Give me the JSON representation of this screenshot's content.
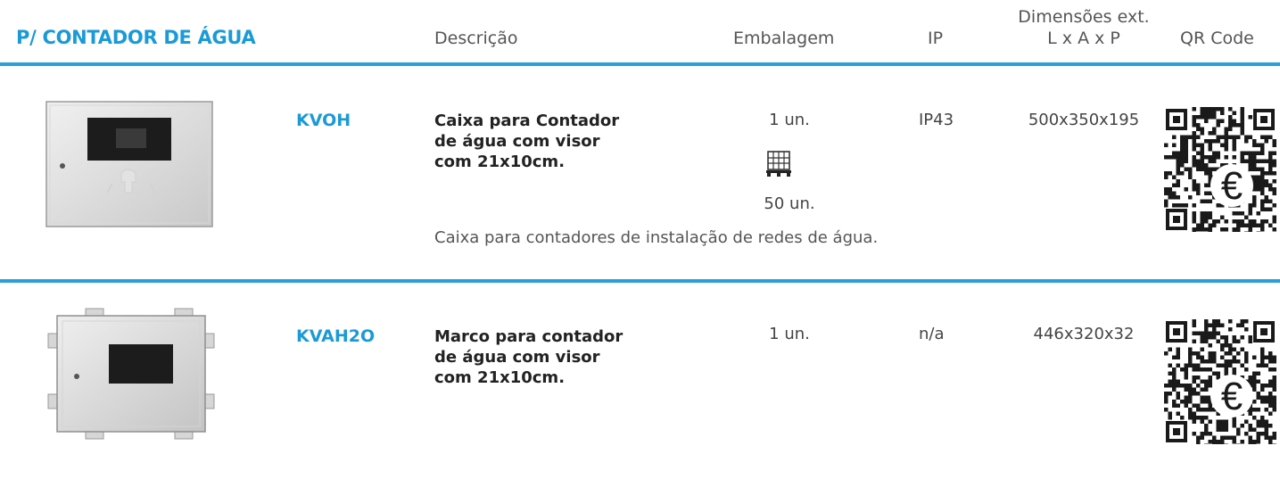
{
  "header": {
    "section_title": "P/ CONTADOR DE ÁGUA",
    "col_descricao": "Descrição",
    "col_embalagem": "Embalagem",
    "col_ip": "IP",
    "col_dimensoes_1": "Dimensões ext.",
    "col_dimensoes_2": "L x A x P",
    "col_qr": "QR Code"
  },
  "colors": {
    "accent": "#1a9ad6",
    "rule": "#2a9fd8"
  },
  "products": [
    {
      "code": "KVOH",
      "desc_line1": "Caixa para Contador",
      "desc_line2": "de água com visor",
      "desc_line3": "com 21x10cm.",
      "pack_unit": "1 un.",
      "pallet_icon": "pallet-icon",
      "pack_pallet": "50 un.",
      "ip": "IP43",
      "dims": "500x350x195",
      "note": "Caixa para contadores de instalação de redes de água.",
      "qr_icon": "qr-code-euro-icon"
    },
    {
      "code": "KVAH2O",
      "desc_line1": "Marco para contador",
      "desc_line2": "de água com visor",
      "desc_line3": "com 21x10cm.",
      "pack_unit": "1 un.",
      "ip": "n/a",
      "dims": "446x320x32",
      "qr_icon": "qr-code-euro-icon"
    }
  ]
}
